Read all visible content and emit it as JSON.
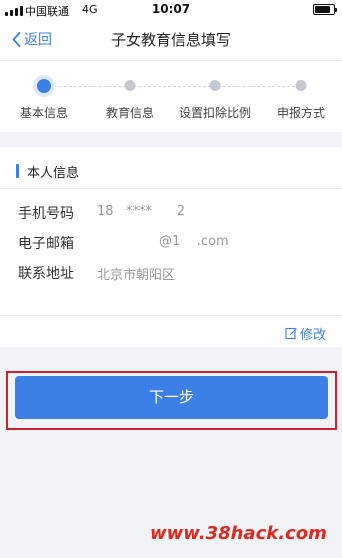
{
  "status_bar": {
    "carrier": "中国联通",
    "network": "4G",
    "time": "10:07",
    "battery_level": 0.85
  },
  "nav": {
    "back_label": "返回",
    "title": "子女教育信息填写"
  },
  "steps": [
    {
      "label": "基本信息",
      "active": true
    },
    {
      "label": "教育信息",
      "active": false
    },
    {
      "label": "设置扣除比例",
      "active": false
    },
    {
      "label": "申报方式",
      "active": false
    }
  ],
  "personal_info": {
    "section_title": "本人信息",
    "rows": [
      {
        "key": "手机号码",
        "value": "18   ****      2"
      },
      {
        "key": "电子邮箱",
        "value": "               @1    .com"
      },
      {
        "key": "联系地址",
        "value": "北京市朝阳区"
      }
    ]
  },
  "edit_label": "修改",
  "next_button": "下一步",
  "watermark": "www.38hack.com",
  "colors": {
    "accent": "#3d80e5",
    "highlight_border": "#d0212b",
    "watermark": "#e0281f"
  }
}
